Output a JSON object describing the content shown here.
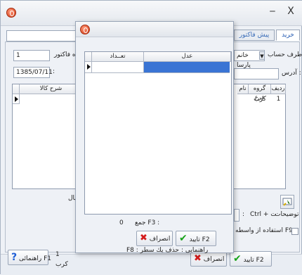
{
  "window": {
    "close_glyph": "X",
    "minimize_glyph": "‒"
  },
  "tabs": [
    "خرید",
    "پیش فاکتور"
  ],
  "form": {
    "account_label": "طرف حساب",
    "account_value": "خانم پارسا",
    "invoice_label": "اره فاکتور :",
    "invoice_value": "1",
    "date_value": "1385/07/11",
    "address_label": "آدرس :",
    "colon": ":"
  },
  "main_grid": {
    "columns": [
      "ردیف",
      "گروه فرع",
      "نام",
      "شرح کالا"
    ],
    "rows": [
      {
        "row": "1",
        "group": "کرب"
      }
    ]
  },
  "footer": {
    "notes_label": "توضیحات",
    "notes_shortcut": "Ctrl + ت",
    "notes_colon": ":",
    "via_label": "استفاده از واسطه F9 :",
    "sidebar_text": "یال",
    "confirm_label": "تایید F2",
    "cancel_label": "انصراف",
    "help_label": "راهنمائی F1",
    "status_count": "1",
    "status_kind": "کرب"
  },
  "dialog": {
    "grid_columns": [
      "عدل",
      "تعــداد"
    ],
    "sum_label": "جمع F3 :",
    "sum_value": "0",
    "confirm_label": "تایید F2",
    "cancel_label": "انصراف",
    "help_text": ": راهنمایی",
    "delete_text": "F8 : حذف یك سطر",
    "selection_color": "#3a74d4"
  },
  "icons": [
    "app-icon",
    "check-icon",
    "x-icon",
    "help-icon",
    "add-row-icon"
  ]
}
